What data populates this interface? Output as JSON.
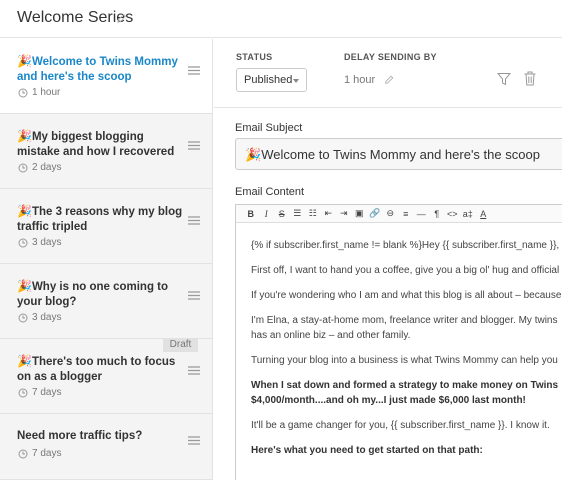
{
  "header": {
    "title": "Welcome Series",
    "edit_icon": "pencil-icon"
  },
  "sidebar": {
    "items": [
      {
        "emoji": "🎉",
        "subject": "Welcome to Twins Mommy and here's the scoop",
        "delay": "1 hour",
        "active": true
      },
      {
        "emoji": "🎉",
        "subject": "My biggest blogging mistake and how I recovered",
        "delay": "2 days",
        "active": false
      },
      {
        "emoji": "🎉",
        "subject": "The 3 reasons why my blog traffic tripled",
        "delay": "3 days",
        "active": false
      },
      {
        "emoji": "🎉",
        "subject": "Why is no one coming to your blog?",
        "delay": "3 days",
        "active": false
      },
      {
        "emoji": "🎉",
        "subject": "There's too much to focus on as a blogger",
        "delay": "7 days",
        "active": false,
        "badge": "Draft"
      },
      {
        "emoji": "",
        "subject": "Need more traffic tips?",
        "delay": "7 days",
        "active": false
      }
    ]
  },
  "settings": {
    "status_label": "STATUS",
    "status_value": "Published",
    "delay_label": "DELAY SENDING BY",
    "delay_value": "1 hour"
  },
  "email": {
    "subject_label": "Email Subject",
    "subject_emoji": "🎉",
    "subject_value": "Welcome to Twins Mommy and here's the scoop",
    "content_label": "Email Content",
    "toolbar": [
      "B",
      "I",
      "S",
      "☰",
      "☷",
      "⇤",
      "⇥",
      "▣",
      "🔗",
      "⊖",
      "≡",
      "—",
      "¶",
      "<>",
      "a‡",
      "A"
    ],
    "paragraphs": [
      {
        "text": "{% if subscriber.first_name != blank %}Hey {{ subscriber.first_name }},",
        "bold": false
      },
      {
        "text": "First off, I want to hand you a coffee, give you a big ol' hug and official",
        "bold": false
      },
      {
        "text": "If you're wondering who I am and what this blog is all about – because",
        "bold": false
      },
      {
        "text": "I'm Elna, a stay-at-home mom, freelance writer and blogger. My twins",
        "bold": false,
        "line2": "has an online biz – and other family."
      },
      {
        "text": "Turning your blog into a business is what Twins Mommy can help you",
        "bold": false
      },
      {
        "text": "When I sat down and formed a strategy to make money on Twins",
        "bold": true,
        "line2": "$4,000/month....and oh my...I just made $6,000 last month!"
      },
      {
        "text": "It'll be a game changer for you, {{ subscriber.first_name }}. I know it.",
        "bold": false
      },
      {
        "text": "Here's what you need to get started on that path:",
        "bold": true
      }
    ]
  }
}
